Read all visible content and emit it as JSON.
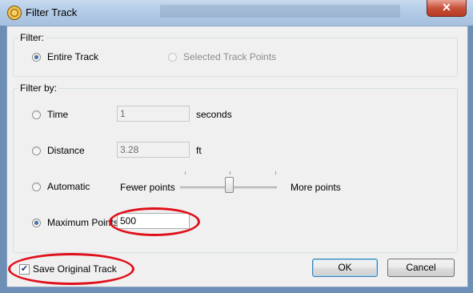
{
  "window": {
    "title": "Filter Track",
    "close_glyph": "✕"
  },
  "filter_group": {
    "legend": "Filter:",
    "entire_track": "Entire Track",
    "selected_points": "Selected Track Points"
  },
  "filter_by_group": {
    "legend": "Filter by:",
    "time": {
      "label": "Time",
      "value": "1",
      "unit": "seconds"
    },
    "distance": {
      "label": "Distance",
      "value": "3.28",
      "unit": "ft"
    },
    "automatic": {
      "label": "Automatic",
      "left_label": "Fewer points",
      "right_label": "More points",
      "slider_level": 0.5
    },
    "maximum_points": {
      "label": "Maximum Points",
      "value": "500"
    }
  },
  "footer": {
    "save_original_label": "Save Original Track",
    "save_original_checked": true,
    "check_glyph": "✔",
    "ok_label": "OK",
    "cancel_label": "Cancel"
  },
  "colors": {
    "annotation": "#e0101a",
    "accent": "#3c7fb1"
  }
}
